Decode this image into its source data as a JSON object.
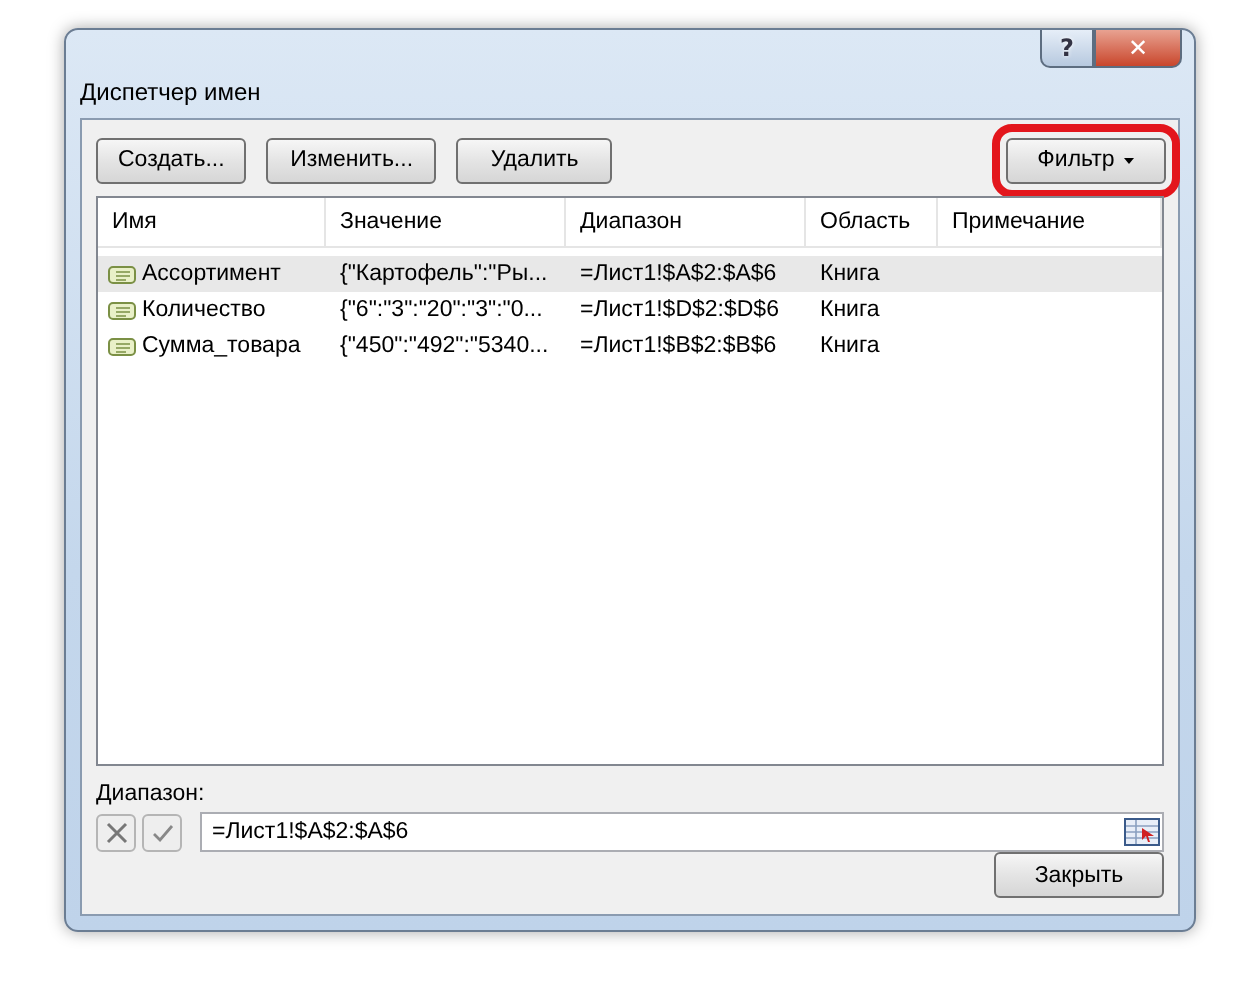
{
  "window": {
    "title": "Диспетчер имен",
    "title_buttons": [
      "?",
      "✕"
    ]
  },
  "toolbar": {
    "buttons": [
      "Создать...",
      "Изменить...",
      "Удалить"
    ],
    "filter": {
      "label": "Фильтр",
      "highlighted": true
    }
  },
  "table": {
    "columns": [
      "Имя",
      "Значение",
      "Диапазон",
      "Область",
      "Примечание"
    ],
    "rows": [
      {
        "name": "Ассортимент",
        "value": "{\"Картофель\":\"Ры...",
        "range": "=Лист1!$A$2:$A$6",
        "scope": "Книга",
        "selected": true
      },
      {
        "name": "Количество",
        "value": "{\"6\":\"3\":\"20\":\"3\":\"0...",
        "range": "=Лист1!$D$2:$D$6",
        "scope": "Книга",
        "selected": false
      },
      {
        "name": "Сумма_товара",
        "value": "{\"450\":\"492\":\"5340...",
        "range": "=Лист1!$B$2:$B$6",
        "scope": "Книга",
        "selected": false
      }
    ]
  },
  "range": {
    "label": "Диапазон:",
    "value": "=Лист1!$A$2:$A$6"
  },
  "close_button": "Закрыть"
}
